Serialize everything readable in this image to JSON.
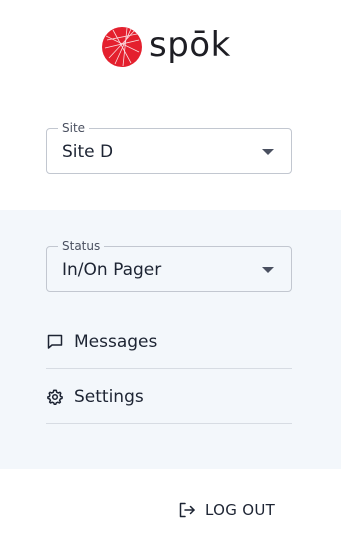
{
  "brand": {
    "name": "spōk",
    "logo_color": "#e4202e"
  },
  "site": {
    "label": "Site",
    "value": "Site D"
  },
  "status": {
    "label": "Status",
    "value": "In/On Pager"
  },
  "menu": {
    "items": [
      {
        "label": "Messages",
        "icon": "chat-bubble-icon"
      },
      {
        "label": "Settings",
        "icon": "gear-icon"
      }
    ]
  },
  "logout": {
    "label": "LOG OUT",
    "icon": "logout-icon"
  },
  "colors": {
    "panel_bg": "#f3f7fb",
    "border": "#c2c7d0",
    "text": "#1d2433"
  }
}
